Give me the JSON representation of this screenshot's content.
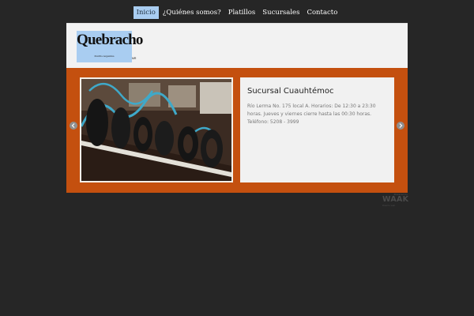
{
  "nav": {
    "items": [
      {
        "label": "Inicio"
      },
      {
        "label": "¿Quiénes somos?"
      },
      {
        "label": "Platillos"
      },
      {
        "label": "Sucursales"
      },
      {
        "label": "Contacto"
      }
    ],
    "active_index": 0,
    "active_color": "#a9cdf1"
  },
  "header": {
    "logo_title": "Quebracho",
    "logo_subtitle": "Parrilla Argentina",
    "logo_suffix": "MR"
  },
  "slider": {
    "band_color": "#c4500f",
    "card_title": "Sucursal Cuauhtémoc",
    "card_text": "Río Lerma No. 175 local A. Horarios: De 12:30 a 23:30 horas. Jueves y viernes cierre hasta las 00:30 horas. Teléfono: 5208 - 3999",
    "prev_icon": "chevron-left-icon",
    "next_icon": "chevron-right-icon"
  },
  "credit": {
    "top": "Powered by",
    "brand": "WAAK",
    "sub": "Diseño web"
  },
  "colors": {
    "page_bg": "#262626",
    "header_bg": "#f2f2f2"
  }
}
